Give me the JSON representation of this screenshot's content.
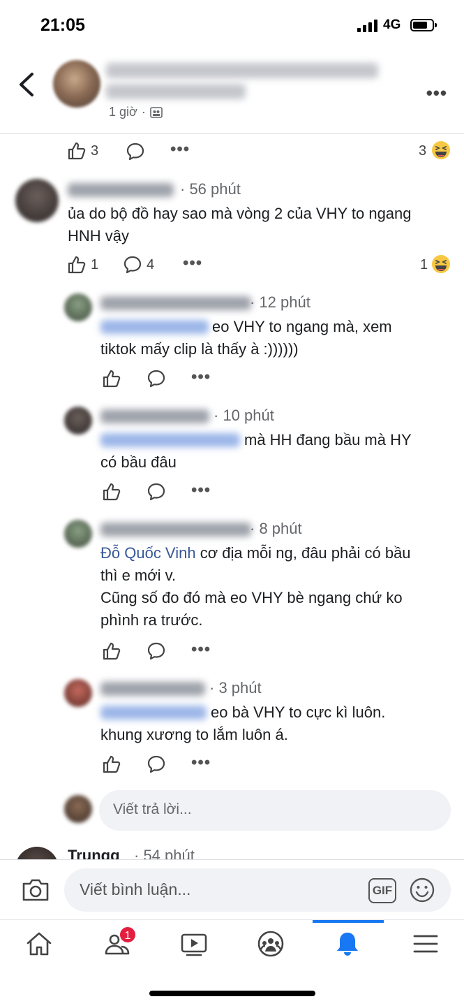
{
  "status_bar": {
    "time": "21:05",
    "network": "4G"
  },
  "post_header": {
    "time_ago": "1 giờ",
    "separator": "·"
  },
  "post_actions": {
    "likes": "3",
    "reactions": "3"
  },
  "comments": [
    {
      "time": "· 56 phút",
      "text": "ủa do bộ đồ hay sao mà vòng 2 của VHY to ngang\nHNH vậy",
      "likes": "1",
      "replies_count": "4",
      "reactions": "1"
    },
    {
      "time": "· 12 phút",
      "text_line1": "eo VHY to ngang mà, xem",
      "text_line2": "tiktok mấy clip là thấy à :))))))"
    },
    {
      "time": "· 10 phút",
      "text_line1": "mà HH đang bầu mà HY",
      "text_line2": "có bầu đâu"
    },
    {
      "time": "· 8 phút",
      "mention": "Đỗ Quốc Vinh",
      "text_line1": " cơ địa mỗi ng, đâu phải có bầu",
      "text_rest": "thì e mới v.\nCũng số đo đó mà eo VHY bè ngang chứ ko\nphình ra trước."
    },
    {
      "time": "· 3 phút",
      "text_line1": "eo bà VHY to cực kì luôn.",
      "text_line2": "khung xương to lắm luôn á."
    }
  ],
  "reply_box": {
    "placeholder": "Viết trả lời..."
  },
  "partial_comment": {
    "name": "Trungg",
    "time": "· 54 phút"
  },
  "composer": {
    "placeholder": "Viết bình luận...",
    "gif_label": "GIF"
  },
  "nav": {
    "friends_badge": "1",
    "active_color": "#1877f2"
  }
}
